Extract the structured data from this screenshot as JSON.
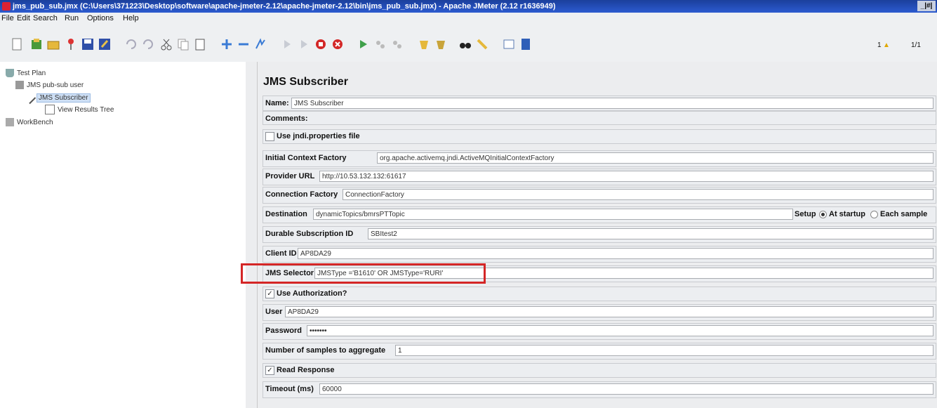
{
  "window": {
    "title": "jms_pub_sub.jmx (C:\\Users\\371223\\Desktop\\software\\apache-jmeter-2.12\\apache-jmeter-2.12\\bin\\jms_pub_sub.jmx) - Apache JMeter (2.12 r1636949)",
    "controls": "_|#|"
  },
  "menu": [
    "File",
    "Edit",
    "Search",
    "Run",
    "Options",
    "Help"
  ],
  "toolbar": {
    "warning_count": "1",
    "thread_count": "1/1",
    "warn_color": "#e0a800"
  },
  "tree": {
    "items": [
      "Test Plan",
      "JMS pub-sub user",
      "JMS Subscriber",
      "View Results Tree",
      "WorkBench"
    ]
  },
  "panel": {
    "title": "JMS Subscriber",
    "name_label": "Name:",
    "name_value": "JMS Subscriber",
    "comments_label": "Comments:",
    "use_jndi_label": "Use jndi.properties file",
    "icf_label": "Initial Context Factory",
    "icf_value": "org.apache.activemq.jndi.ActiveMQInitialContextFactory",
    "provider_label": "Provider URL",
    "provider_value": "http://10.53.132.132:61617",
    "conn_label": "Connection Factory",
    "conn_value": "ConnectionFactory",
    "dest_label": "Destination",
    "dest_value": "dynamicTopics/bmrsPTTopic",
    "setup_label": "Setup",
    "at_startup_label": "At startup",
    "each_sample_label": "Each sample",
    "durable_label": "Durable Subscription ID",
    "durable_value": "SBItest2",
    "client_label": "Client ID",
    "client_value": "AP8DA29",
    "selector_label": "JMS Selector",
    "selector_value": "JMSType ='B1610' OR JMSType='RURI'",
    "use_auth_label": "Use Authorization?",
    "user_label": "User",
    "user_value": "AP8DA29",
    "password_label": "Password",
    "password_value": "•••••••",
    "samples_label": "Number of samples to aggregate",
    "samples_value": "1",
    "read_label": "Read Response",
    "timeout_label": "Timeout (ms)",
    "timeout_value": "60000"
  },
  "colors": {
    "highlight": "#d42626",
    "titlebar": "#2c5bd0"
  }
}
